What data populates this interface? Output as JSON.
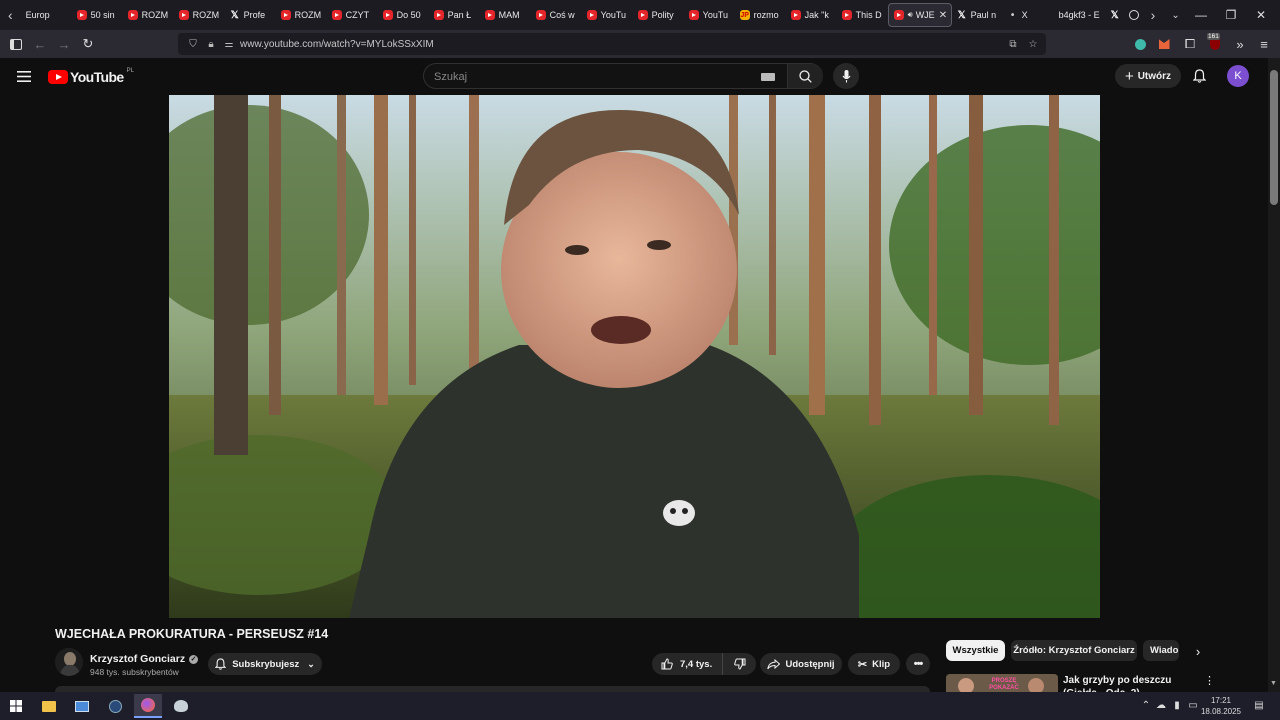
{
  "browser": {
    "tabs": [
      {
        "label": "Europ",
        "icon": "none"
      },
      {
        "label": "50 sin",
        "icon": "youtube"
      },
      {
        "label": "ROZM",
        "icon": "youtube"
      },
      {
        "label": "ROZM",
        "icon": "youtube"
      },
      {
        "label": "Profe",
        "icon": "x"
      },
      {
        "label": "ROZM",
        "icon": "youtube"
      },
      {
        "label": "CZYT",
        "icon": "youtube"
      },
      {
        "label": "Do 50",
        "icon": "youtube"
      },
      {
        "label": "Pan Ł",
        "icon": "youtube"
      },
      {
        "label": "MAM",
        "icon": "youtube"
      },
      {
        "label": "Coś w",
        "icon": "youtube"
      },
      {
        "label": "YouTu",
        "icon": "youtube"
      },
      {
        "label": "Polity",
        "icon": "youtube"
      },
      {
        "label": "YouTu",
        "icon": "youtube"
      },
      {
        "label": "rozmo",
        "icon": "jp"
      },
      {
        "label": "Jak \"k",
        "icon": "youtube"
      },
      {
        "label": "This D",
        "icon": "youtube"
      },
      {
        "label": "WJE",
        "icon": "youtube",
        "active": true
      },
      {
        "label": "Paul n",
        "icon": "x"
      },
      {
        "label": "X",
        "icon": "dot"
      },
      {
        "label": "b4gkf3 - E",
        "icon": "none"
      },
      {
        "label": "",
        "icon": "x"
      }
    ],
    "jp_badge": "JP",
    "url": "www.youtube.com/watch?v=MYLokSSxXIM",
    "ext_badge_count": "161"
  },
  "youtube": {
    "logo_text": "YouTube",
    "logo_country": "PL",
    "search_placeholder": "Szukaj",
    "create_label": "Utwórz",
    "avatar_letter": "K",
    "video": {
      "title": "WJECHAŁA PROKURATURA - PERSEUSZ #14",
      "channel_name": "Krzysztof Gonciarz",
      "subscribers": "948 tys. subskrybentów",
      "subscribe_label": "Subskrybujesz",
      "likes": "7,4 tys.",
      "share_label": "Udostępnij",
      "clip_label": "Klip"
    },
    "chips": [
      "Wszystkie",
      "Źródło: Krzysztof Gonciarz",
      "Wiado"
    ],
    "recommendation": {
      "title": "Jak grzyby po deszczu (Giełda - Odc. 2)",
      "thumb_text": "PROSZĘ POKAZAĆ"
    }
  },
  "taskbar": {
    "time": "17:21",
    "date": "18.08.2025"
  }
}
